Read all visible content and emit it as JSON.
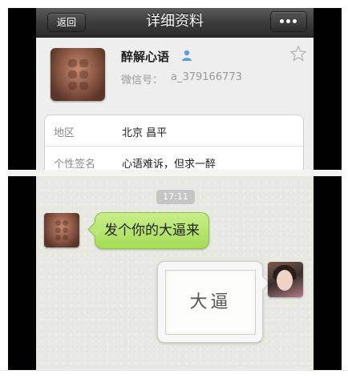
{
  "profile_screen": {
    "nav": {
      "back_label": "返回",
      "title": "详细资料",
      "more_icon": "more-dots-icon"
    },
    "user": {
      "name": "醉解心语",
      "gender_icon": "user-icon",
      "wechat_label": "微信号：",
      "wechat_id": "a_379166773",
      "star_icon": "star-icon"
    },
    "info": [
      {
        "key": "地区",
        "value": "北京 昌平"
      },
      {
        "key": "个性签名",
        "value": "心语难诉，但求一醉"
      }
    ]
  },
  "chat_screen": {
    "timestamp": "17:11",
    "messages": [
      {
        "side": "left",
        "type": "text",
        "text": "发个你的大逼来"
      },
      {
        "side": "right",
        "type": "image",
        "image_text": "大逼"
      }
    ]
  },
  "colors": {
    "nav_bar": "#3a3a3a",
    "sent_bubble": "#a6dc55",
    "chat_background": "#e9e9e4",
    "timestamp_badge": "#c5c5c5"
  }
}
